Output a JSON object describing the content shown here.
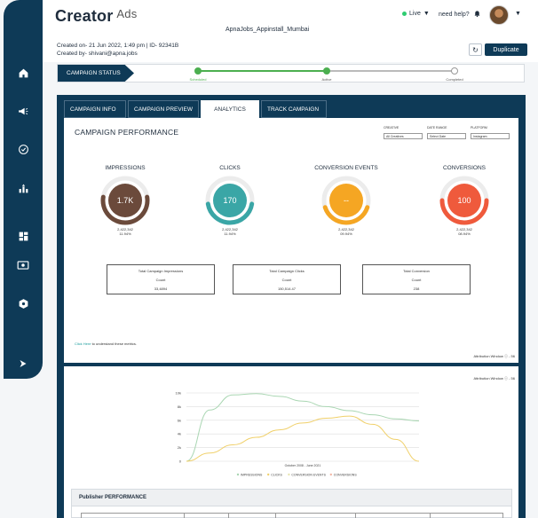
{
  "header": {
    "brand": "Creator",
    "brand_suffix": "Ads",
    "campaign_name": "ApnaJobs_Appinstall_Mumbai",
    "live_label": "Live",
    "help_label": "need help?",
    "created_on": "Created on- 21 Jun 2022, 1:49 pm | ID- 92341B",
    "created_by": "Created by- shivani@apna.jobs",
    "duplicate_label": "Duplicate",
    "refresh_icon": "refresh-icon"
  },
  "sidebar": {
    "items": [
      {
        "icon": "home-icon"
      },
      {
        "icon": "megaphone-icon"
      },
      {
        "icon": "check-circle-icon"
      },
      {
        "icon": "bar-chart-icon"
      },
      {
        "icon": "dashboard-icon"
      },
      {
        "icon": "cash-icon"
      },
      {
        "icon": "settings-hex-icon"
      },
      {
        "icon": "expand-arrow-icon"
      }
    ]
  },
  "status": {
    "label": "CAMPAIGN STATUS",
    "steps": [
      {
        "label": "Scheduled",
        "state": "done"
      },
      {
        "label": "Active",
        "state": "done"
      },
      {
        "label": "Completed",
        "state": "pending"
      }
    ],
    "done_color": "#4caf50",
    "pending_color": "#bbbbbb"
  },
  "tabs": [
    {
      "label": "CAMPAIGN INFO",
      "active": false
    },
    {
      "label": "CAMPAIGN PREVIEW",
      "active": false
    },
    {
      "label": "ANALYTICS",
      "active": true
    },
    {
      "label": "TRACK CAMPAIGN",
      "active": false
    }
  ],
  "performance": {
    "title": "CAMPAIGN PERFORMANCE",
    "filters": [
      {
        "label": "CREATIVE",
        "value": "All Creatives"
      },
      {
        "label": "DATE RANGE",
        "value": "Select Date"
      },
      {
        "label": "PLATFORM",
        "value": "Instagram"
      }
    ],
    "metrics": [
      {
        "title": "IMPRESSIONS",
        "value": "1.7K",
        "sub1": "2,422,342",
        "sub2": "11.94%",
        "color": "#6b4a3b",
        "progress": 0.55
      },
      {
        "title": "CLICKS",
        "value": "170",
        "sub1": "2,422,342",
        "sub2": "11.94%",
        "color": "#3aa6a6",
        "progress": 0.45
      },
      {
        "title": "CONVERSION EVENTS",
        "value": "--",
        "sub1": "2,422,342",
        "sub2": "09.94%",
        "color": "#f5a623",
        "progress": 0.4
      },
      {
        "title": "CONVERSIONS",
        "value": "100",
        "sub1": "2,422,342",
        "sub2": "08.94%",
        "color": "#ef5a3c",
        "progress": 0.5
      }
    ],
    "kpis": [
      {
        "title": "Total Campaign Impressions",
        "unit": "Count",
        "value": "33,4894"
      },
      {
        "title": "Total Campaign Clicks",
        "unit": "Count",
        "value": "150,514.47"
      },
      {
        "title": "Total Conversion",
        "unit": "Count",
        "value": "238"
      }
    ],
    "click_here_link": "Click Here",
    "click_here_rest": " to understand these metrics.",
    "attribution": "Attribution Window ⓘ - 56"
  },
  "chart_data": {
    "type": "line",
    "title": "",
    "xlabel": "October 2008 - June 2021",
    "ylabel": "",
    "y_ticks": [
      "0",
      "2k",
      "4k",
      "6k",
      "8k",
      "10k"
    ],
    "ylim": [
      0,
      10000
    ],
    "x": [
      0,
      1,
      2,
      3,
      4,
      5,
      6,
      7,
      8,
      9,
      10
    ],
    "series": [
      {
        "name": "IMPRESSIONS",
        "color": "#a9d6b2",
        "values": [
          0,
          7500,
          9700,
          9900,
          9500,
          8800,
          8000,
          7400,
          6800,
          6200,
          5900
        ]
      },
      {
        "name": "CLICKS",
        "color": "#f0d06a",
        "values": [
          0,
          1200,
          2400,
          3500,
          4600,
          5600,
          6300,
          6600,
          5400,
          3200,
          0
        ]
      },
      {
        "name": "CONVERSION EVENTS",
        "color": "#e8e6b0",
        "values": [
          0,
          0,
          0,
          0,
          0,
          0,
          0,
          0,
          0,
          0,
          0
        ]
      },
      {
        "name": "CONVERSIONS",
        "color": "#f3b7a6",
        "values": [
          0,
          0,
          0,
          0,
          0,
          0,
          0,
          0,
          0,
          0,
          0
        ]
      }
    ],
    "legend_position": "bottom",
    "attribution": "Attribution Window ⓘ - 56"
  },
  "publisher": {
    "title": "Publisher PERFORMANCE"
  }
}
